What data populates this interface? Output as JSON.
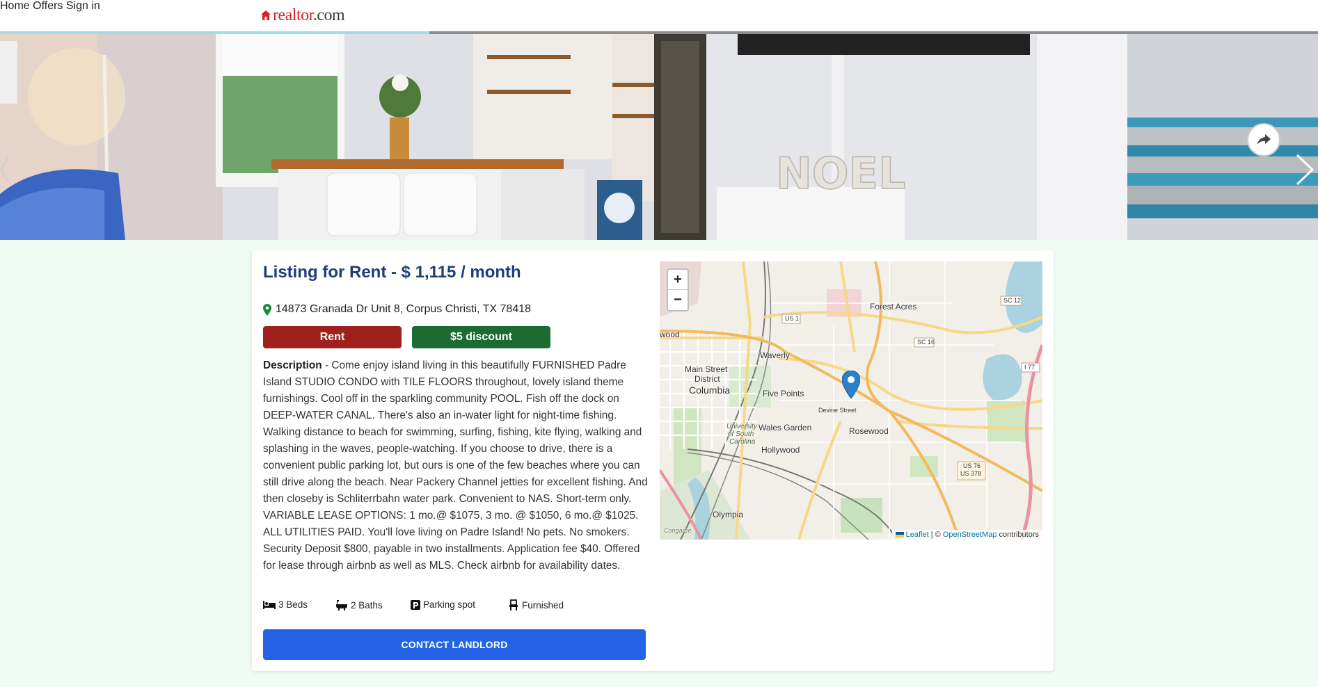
{
  "brand": {
    "part1": "realtor",
    "part2": ".com"
  },
  "nav": {
    "home": "Home",
    "offers": "Offers",
    "signin": "Sign in"
  },
  "hero": {
    "progress_fraction": 0.326,
    "photo_sign": "NOEL"
  },
  "listing": {
    "title": "Listing for Rent - $ 1,115 / month",
    "address": "14873 Granada Dr Unit 8, Corpus Christi, TX 78418",
    "tag_rent": "Rent",
    "tag_discount": "$5 discount",
    "desc_label": "Description",
    "description": " - Come enjoy island living in this beautifully FURNISHED Padre Island STUDIO CONDO with TILE FLOORS throughout, lovely island theme furnishings. Cool off in the sparkling community POOL. Fish off the dock on DEEP-WATER CANAL. There's also an in-water light for night-time fishing. Walking distance to beach for swimming, surfing, fishing, kite flying, walking and splashing in the waves, people-watching. If you choose to drive, there is a convenient public parking lot, but ours is one of the few beaches where you can still drive along the beach. Near Packery Channel jetties for excellent fishing. And then closeby is Schliterrbahn water park. Convenient to NAS. Short-term only. VARIABLE LEASE OPTIONS: 1 mo.@ $1075, 3 mo. @ $1050, 6 mo.@ $1025. ALL UTILITIES PAID. You'll love living on Padre Island! No pets. No smokers. Security Deposit $800, payable in two installments. Application fee $40. Offered for lease through airbnb as well as MLS. Check airbnb for availability dates.",
    "features": {
      "beds": "3 Beds",
      "baths": "2 Baths",
      "parking": "Parking spot",
      "furnished": "Furnished"
    },
    "contact": "CONTACT LANDLORD"
  },
  "map": {
    "zoom_in": "+",
    "zoom_out": "−",
    "labels": {
      "forest_acres": "Forest Acres",
      "waverly": "Waverly",
      "main_street": "Main Street",
      "district": "District",
      "columbia": "Columbia",
      "five_points": "Five Points",
      "wales_garden": "Wales Garden",
      "rosewood": "Rosewood",
      "hollywood": "Hollywood",
      "olympia": "Olympia",
      "university1": "University",
      "university2": "of South",
      "university3": "Carolina",
      "wood": "wood",
      "devine": "Devine Street",
      "us1": "US 1",
      "sc16": "SC 16",
      "sc12": "SC 12",
      "i77": "I 77",
      "us76": "US 76",
      "us378": "US 378",
      "congaree": "Congaree"
    },
    "attrib_leaflet": "Leaflet",
    "attrib_sep": " | © ",
    "attrib_osm": "OpenStreetMap",
    "attrib_contrib": " contributors"
  }
}
